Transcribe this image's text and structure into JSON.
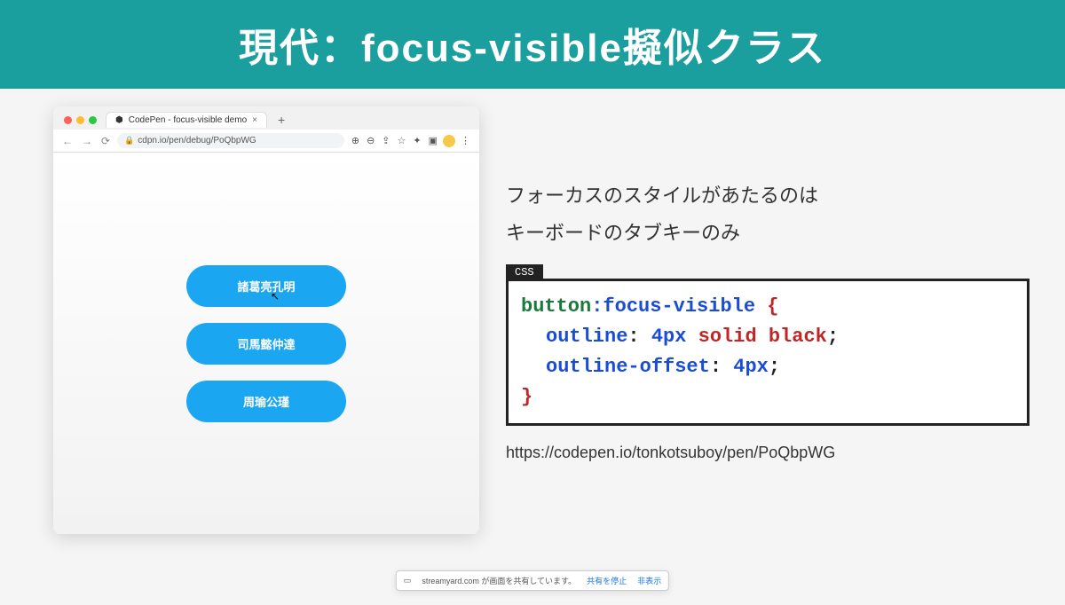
{
  "header": {
    "title": "現代：focus-visible擬似クラス"
  },
  "browser": {
    "tab_title": "CodePen - focus-visible demo",
    "address": "cdpn.io/pen/debug/PoQbpWG"
  },
  "demo": {
    "buttons": [
      "諸葛亮孔明",
      "司馬懿仲達",
      "周瑜公瑾"
    ]
  },
  "right": {
    "paragraph_line1": "フォーカスのスタイルがあたるのは",
    "paragraph_line2": "キーボードのタブキーのみ",
    "code_label": "CSS",
    "code": {
      "selector": "button",
      "pseudo": ":focus-visible",
      "open": " {",
      "prop1": "outline",
      "val1_px": "4px",
      "val1_kw1": "solid",
      "val1_kw2": "black",
      "prop2": "outline-offset",
      "val2_px": "4px",
      "close": "}"
    },
    "url": "https://codepen.io/tonkotsuboy/pen/PoQbpWG"
  },
  "share": {
    "msg": "streamyard.com が画面を共有しています。",
    "stop": "共有を停止",
    "hide": "非表示"
  }
}
